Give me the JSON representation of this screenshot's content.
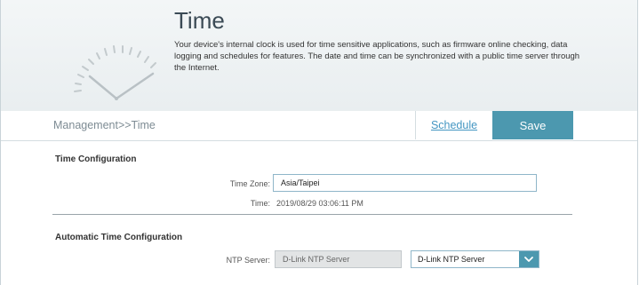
{
  "header": {
    "title": "Time",
    "description": "Your device's internal clock is used for time sensitive applications, such as firmware online checking, data logging and schedules for features. The date and time can be synchronized with a public time server through the Internet.",
    "icon": "clock-gauge-icon"
  },
  "nav": {
    "breadcrumb": "Management>>Time",
    "schedule_label": "Schedule",
    "save_label": "Save"
  },
  "time_configuration": {
    "title": "Time Configuration",
    "time_zone_label": "Time Zone:",
    "time_zone_value": "Asia/Taipei",
    "time_label": "Time:",
    "time_value": "2019/08/29 03:06:11 PM"
  },
  "automatic_time_configuration": {
    "title": "Automatic Time Configuration",
    "ntp_server_label": "NTP Server:",
    "ntp_server_value": "D-Link NTP Server",
    "ntp_select_value": "D-Link NTP Server"
  },
  "colors": {
    "accent": "#4c98af",
    "link": "#4496c2"
  }
}
